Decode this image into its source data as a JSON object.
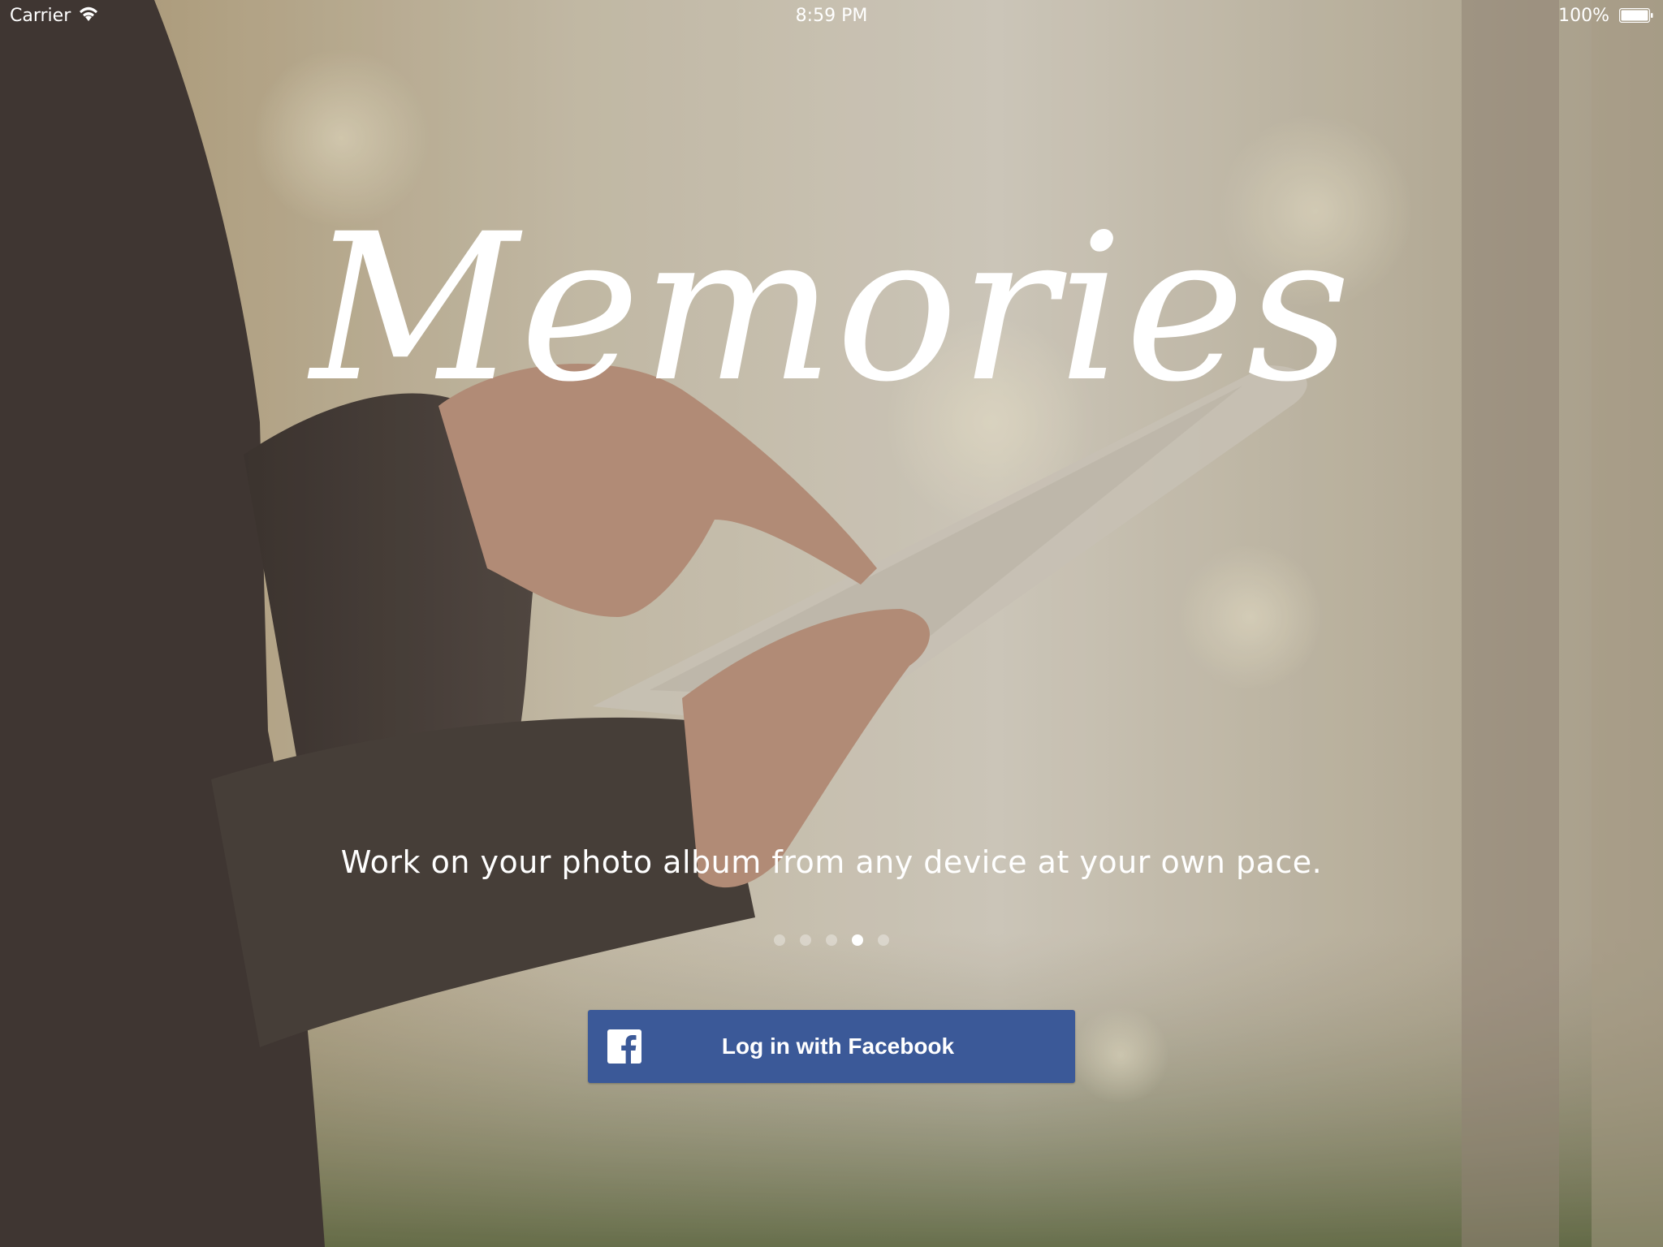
{
  "status_bar": {
    "carrier": "Carrier",
    "time": "8:59 PM",
    "battery": "100%"
  },
  "hero": {
    "title": "Memories",
    "tagline": "Work on your photo album from any device at your own pace."
  },
  "pager": {
    "pages": 5,
    "current": 4
  },
  "login": {
    "label": "Log in with Facebook",
    "icon": "facebook-icon",
    "color": "#3b5998"
  }
}
